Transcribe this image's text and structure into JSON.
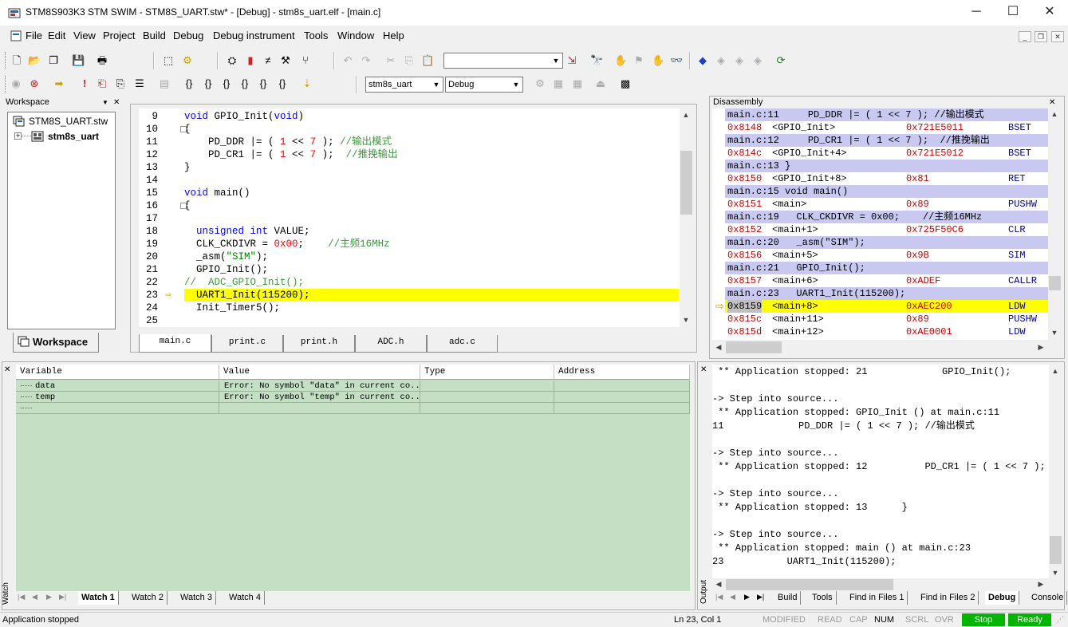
{
  "window": {
    "title": "STM8S903K3 STM SWIM - STM8S_UART.stw* - [Debug] - stm8s_uart.elf - [main.c]",
    "minimize": "─",
    "maximize": "☐",
    "close": "✕"
  },
  "menu": {
    "items": [
      "File",
      "Edit",
      "View",
      "Project",
      "Build",
      "Debug",
      "Debug instrument",
      "Tools",
      "Window",
      "Help"
    ],
    "mdi_min": "_",
    "mdi_restore": "❐",
    "mdi_close": "✕"
  },
  "toolbar": {
    "project_combo": "stm8s_uart",
    "config_combo": "Debug",
    "find_combo": ""
  },
  "workspace": {
    "title": "Workspace",
    "root": "STM8S_UART.stw",
    "project": "stm8s_uart",
    "tab": "Workspace"
  },
  "editor": {
    "lines": [
      {
        "n": "9",
        "parts": [
          [
            "kw",
            "void "
          ],
          [
            "",
            "GPIO_Init("
          ],
          [
            "kw",
            "void"
          ],
          [
            "",
            ")"
          ]
        ]
      },
      {
        "n": "10",
        "parts": [
          [
            "",
            "{"
          ]
        ]
      },
      {
        "n": "11",
        "parts": [
          [
            "",
            "    PD_DDR |= ( "
          ],
          [
            "num",
            "1"
          ],
          [
            "",
            " << "
          ],
          [
            "num",
            "7"
          ],
          [
            "",
            " ); "
          ],
          [
            "cmt",
            "//输出模式"
          ]
        ]
      },
      {
        "n": "12",
        "parts": [
          [
            "",
            "    PD_CR1 |= ( "
          ],
          [
            "num",
            "1"
          ],
          [
            "",
            " << "
          ],
          [
            "num",
            "7"
          ],
          [
            "",
            " );  "
          ],
          [
            "cmt",
            "//推挽输出"
          ]
        ]
      },
      {
        "n": "13",
        "parts": [
          [
            "",
            "}"
          ]
        ]
      },
      {
        "n": "14",
        "parts": [
          [
            "",
            ""
          ]
        ]
      },
      {
        "n": "15",
        "parts": [
          [
            "kw",
            "void "
          ],
          [
            "",
            "main()"
          ]
        ]
      },
      {
        "n": "16",
        "parts": [
          [
            "",
            "{"
          ]
        ]
      },
      {
        "n": "17",
        "parts": [
          [
            "",
            ""
          ]
        ]
      },
      {
        "n": "18",
        "parts": [
          [
            "kw",
            "  unsigned int "
          ],
          [
            "",
            "VALUE;"
          ]
        ]
      },
      {
        "n": "19",
        "parts": [
          [
            "",
            "  CLK_CKDIVR = "
          ],
          [
            "num",
            "0x00"
          ],
          [
            "",
            ";    "
          ],
          [
            "cmt",
            "//主频16MHz"
          ]
        ]
      },
      {
        "n": "20",
        "parts": [
          [
            "",
            "  _asm("
          ],
          [
            "str",
            "\"SIM\""
          ],
          [
            "",
            ");"
          ]
        ]
      },
      {
        "n": "21",
        "parts": [
          [
            "",
            "  GPIO_Init();"
          ]
        ]
      },
      {
        "n": "22",
        "parts": [
          [
            "cmt",
            "//  ADC_GPIO_Init();"
          ]
        ]
      },
      {
        "n": "23",
        "parts": [
          [
            "",
            "  UART1_Init(115200);"
          ]
        ]
      },
      {
        "n": "24",
        "parts": [
          [
            "",
            "  Init_Timer5();"
          ]
        ]
      },
      {
        "n": "25",
        "parts": [
          [
            "",
            ""
          ]
        ]
      }
    ],
    "tabs": [
      "main.c",
      "print.c",
      "print.h",
      "ADC.h",
      "adc.c"
    ]
  },
  "disassembly": {
    "title": "Disassembly",
    "rows": [
      {
        "src": "main.c:11     PD_DDR |= ( 1 << 7 ); //输出模式"
      },
      {
        "addr": "0x8148",
        "sym": "<GPIO_Init>",
        "code": "0x721E5011",
        "op": "BSET"
      },
      {
        "src": "main.c:12     PD_CR1 |= ( 1 << 7 );  //推挽输出"
      },
      {
        "addr": "0x814c",
        "sym": "<GPIO_Init+4>",
        "code": "0x721E5012",
        "op": "BSET"
      },
      {
        "src": "main.c:13 }"
      },
      {
        "addr": "0x8150",
        "sym": "<GPIO_Init+8>",
        "code": "0x81",
        "op": "RET"
      },
      {
        "src": "main.c:15 void main()"
      },
      {
        "addr": "0x8151",
        "sym": "<main>",
        "code": "0x89",
        "op": "PUSHW"
      },
      {
        "src": "main.c:19   CLK_CKDIVR = 0x00;    //主频16MHz"
      },
      {
        "addr": "0x8152",
        "sym": "<main+1>",
        "code": "0x725F50C6",
        "op": "CLR"
      },
      {
        "src": "main.c:20   _asm(\"SIM\");"
      },
      {
        "addr": "0x8156",
        "sym": "<main+5>",
        "code": "0x9B",
        "op": "SIM"
      },
      {
        "src": "main.c:21   GPIO_Init();"
      },
      {
        "addr": "0x8157",
        "sym": "<main+6>",
        "code": "0xADEF",
        "op": "CALLR"
      },
      {
        "src": "main.c:23   UART1_Init(115200);"
      },
      {
        "addr": "0x8159",
        "sym": "<main+8>",
        "code": "0xAEC200",
        "op": "LDW",
        "current": true
      },
      {
        "addr": "0x815c",
        "sym": "<main+11>",
        "code": "0x89",
        "op": "PUSHW"
      },
      {
        "addr": "0x815d",
        "sym": "<main+12>",
        "code": "0xAE0001",
        "op": "LDW"
      }
    ]
  },
  "watch": {
    "side_label": "Watch",
    "headers": [
      "Variable",
      "Value",
      "Type",
      "Address"
    ],
    "rows": [
      {
        "var": "data",
        "value": "Error: No symbol \"data\" in current co...",
        "type": "",
        "address": ""
      },
      {
        "var": "temp",
        "value": "Error: No symbol \"temp\" in current co...",
        "type": "",
        "address": ""
      },
      {
        "var": "",
        "value": "",
        "type": "",
        "address": ""
      }
    ],
    "tabs": [
      "Watch 1",
      "Watch 2",
      "Watch 3",
      "Watch 4"
    ],
    "active_tab": "Watch 1"
  },
  "output": {
    "side_label": "Output",
    "lines": [
      " ** Application stopped: 21             GPIO_Init();",
      "",
      "-> Step into source...",
      " ** Application stopped: GPIO_Init () at main.c:11",
      "11             PD_DDR |= ( 1 << 7 ); //输出模式",
      "",
      "-> Step into source...",
      " ** Application stopped: 12          PD_CR1 |= ( 1 << 7 );",
      "",
      "-> Step into source...",
      " ** Application stopped: 13      }",
      "",
      "-> Step into source...",
      " ** Application stopped: main () at main.c:23",
      "23           UART1_Init(115200);"
    ],
    "tabs": [
      "Build",
      "Tools",
      "Find in Files 1",
      "Find in Files 2",
      "Debug",
      "Console"
    ],
    "active_tab": "Debug"
  },
  "status": {
    "message": "Application stopped",
    "position": "Ln 23, Col 1",
    "modified": "MODIFIED",
    "read": "READ",
    "cap": "CAP",
    "num": "NUM",
    "scrl": "SCRL",
    "ovr": "OVR",
    "stop": "Stop",
    "ready": "Ready",
    "green": "#00b400"
  }
}
